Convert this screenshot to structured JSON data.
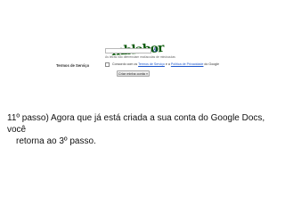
{
  "signup": {
    "captcha_word": "mblabor",
    "speaker_icon": "speaker-icon",
    "hint": "As letras não diferenciam maiúsculas de minúsculas",
    "tos_title": "Termos de Serviço",
    "agree_prefix": "Concordo com os ",
    "tos_link": "Termos de Serviço",
    "agree_middle": " e a ",
    "privacy_link": "Política de Privacidade",
    "agree_suffix": " do Google",
    "create_button": "Criar minha conta »"
  },
  "caption": {
    "line1": "11º  passo)  Agora que já está criada a sua conta do Google Docs, você",
    "line2": "retorna ao 3º passo."
  }
}
